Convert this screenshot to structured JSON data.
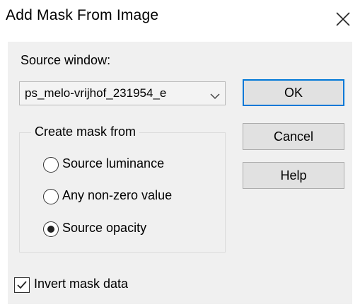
{
  "window": {
    "title": "Add Mask From Image",
    "close_icon": "close-icon"
  },
  "source": {
    "label": "Source window:",
    "selected": "ps_melo-vrijhof_231954_e"
  },
  "group": {
    "title": "Create mask from",
    "options": [
      {
        "label": "Source luminance",
        "selected": false
      },
      {
        "label": "Any non-zero value",
        "selected": false
      },
      {
        "label": "Source opacity",
        "selected": true
      }
    ]
  },
  "invert": {
    "label": "Invert mask data",
    "checked": true
  },
  "buttons": {
    "ok": "OK",
    "cancel": "Cancel",
    "help": "Help"
  },
  "colors": {
    "accent": "#0078d7",
    "panel": "#f0f0f0",
    "button": "#e1e1e1"
  }
}
